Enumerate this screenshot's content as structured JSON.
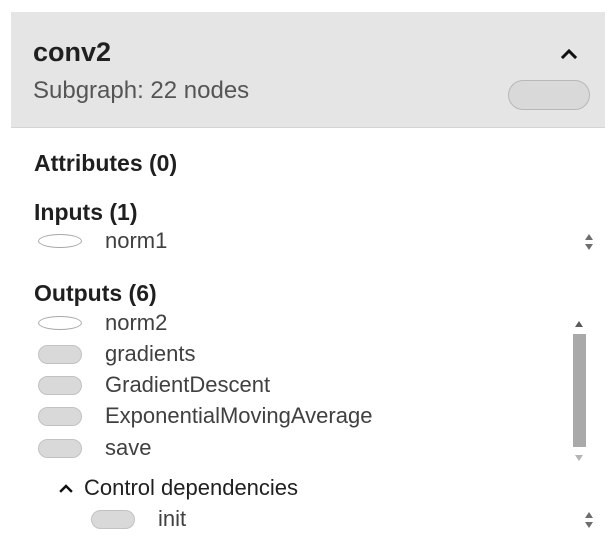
{
  "header": {
    "title": "conv2",
    "subtitle": "Subgraph: 22 nodes"
  },
  "attributes": {
    "title": "Attributes (0)"
  },
  "inputs": {
    "title": "Inputs (1)",
    "items": [
      {
        "label": "norm1",
        "shape": "ellipse"
      }
    ]
  },
  "outputs": {
    "title": "Outputs (6)",
    "items": [
      {
        "label": "norm2",
        "shape": "ellipse"
      },
      {
        "label": "gradients",
        "shape": "pill"
      },
      {
        "label": "GradientDescent",
        "shape": "pill"
      },
      {
        "label": "ExponentialMovingAverage",
        "shape": "pill"
      },
      {
        "label": "save",
        "shape": "pill"
      }
    ]
  },
  "control_dependencies": {
    "label": "Control dependencies",
    "items": [
      {
        "label": "init",
        "shape": "pill"
      }
    ]
  },
  "icons": {
    "collapse": "chevron-up-icon",
    "toggle": "chevron-up-icon",
    "spinner": "up-down-arrows-icon"
  },
  "colors": {
    "header_bg": "#e5e5e5",
    "node_fill": "#d9d9d9",
    "scroll_thumb": "#a9a9a9"
  }
}
